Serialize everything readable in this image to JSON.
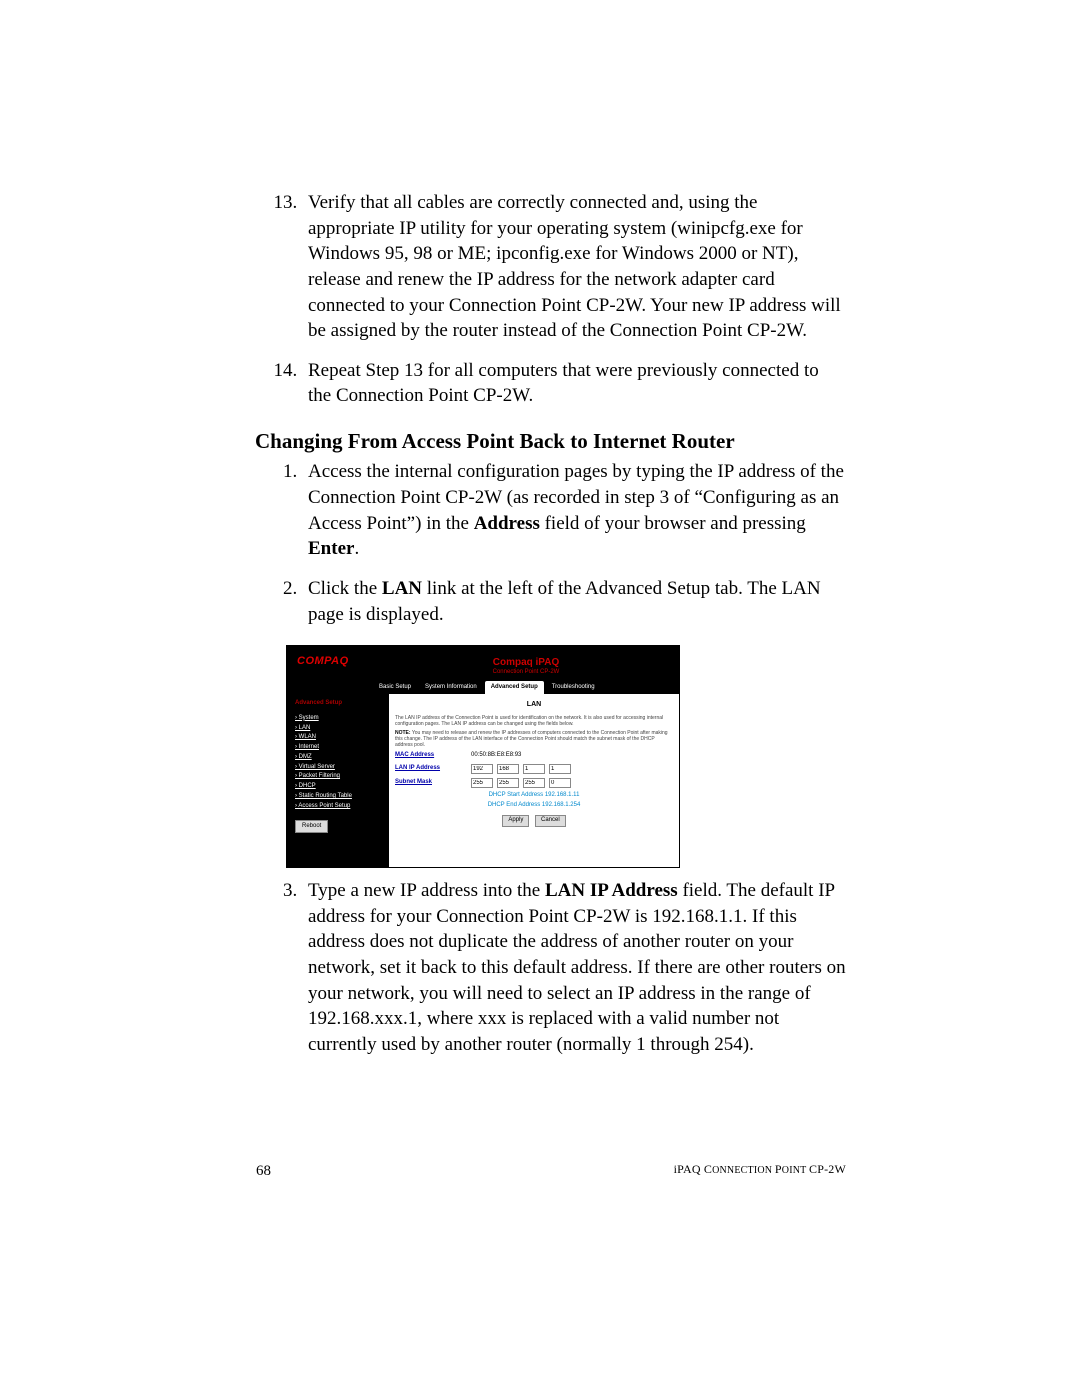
{
  "steps_top": {
    "13": "Verify that all cables are correctly connected and, using the appropriate IP utility for your operating system (winipcfg.exe for Windows 95, 98 or ME; ipconfig.exe for Windows 2000 or NT), release and renew the IP address for the network adapter card connected to your Connection Point CP-2W. Your new IP address will be assigned by the router instead of the Connection Point CP-2W.",
    "14": "Repeat Step 13 for all computers that were previously connected to the Connection Point CP-2W."
  },
  "subheading": "Changing From Access Point Back to Internet Router",
  "steps_mid": {
    "1_a": "Access the internal configuration pages by typing the IP address of the Connection Point CP-2W (as recorded in step 3 of “Configuring as an Access Point”) in the ",
    "1_bold": "Address",
    "1_b": " field of your browser and pressing ",
    "1_bold2": "Enter",
    "1_c": ".",
    "2_a": "Click the ",
    "2_bold": "LAN",
    "2_b": " link at the left of the Advanced Setup tab. The LAN page is displayed."
  },
  "router": {
    "brand": "COMPAQ",
    "product_title": "Compaq iPAQ",
    "product_sub": "Connection Point CP-2W",
    "tabs": [
      "Basic Setup",
      "System Information",
      "Advanced Setup",
      "Troubleshooting"
    ],
    "active_tab_index": 2,
    "sidebar_heading": "Advanced Setup",
    "nav": [
      "› System",
      "› LAN",
      "› WLAN",
      "› Internet",
      "› DMZ",
      "› Virtual Server",
      "› Packet Filtering",
      "› DHCP",
      "› Static Routing Table",
      "› Access Point Setup"
    ],
    "reboot_btn": "Reboot",
    "panel_title": "LAN",
    "desc": "The LAN IP address of the Connection Point is used for identification on the network. It is also used for accessing internal configuration pages. The LAN IP address can be changed using the fields below.",
    "note_label": "NOTE:",
    "note_text": " You may need to release and renew the IP addresses of computers connected to the Connection Point after making this change. The IP address of the LAN interface of the Connection Point should match the subnet mask of the DHCP address pool.",
    "mac_label": "MAC Address",
    "mac_value": "00:50:8B:E8:E8:93",
    "lan_ip_label": "LAN IP Address",
    "lan_ip": [
      "192",
      "168",
      "1",
      "1"
    ],
    "subnet_label": "Subnet Mask",
    "subnet": [
      "255",
      "255",
      "255",
      "0"
    ],
    "dhcp_start_label": "DHCP Start Address 192.168.1.11",
    "dhcp_end_label": "DHCP End Address 192.168.1.254",
    "apply": "Apply",
    "cancel": "Cancel"
  },
  "step3": {
    "a": "Type a new IP address into the ",
    "bold": "LAN IP Address",
    "b": " field. The default IP address for your Connection Point CP-2W is 192.168.1.1. If this address does not duplicate the address of another router on your network, set it back to this default address. If there are other routers on your network, you will need to select an IP address in the range of 192.168.xxx.1, where xxx is replaced with a valid number not currently used by another router (normally 1 through 254)."
  },
  "footer": {
    "page_number": "68",
    "product_line_a": "iPAQ C",
    "product_line_b": "ONNECTION ",
    "product_line_c": "P",
    "product_line_d": "OINT ",
    "product_line_e": "CP-2W"
  }
}
